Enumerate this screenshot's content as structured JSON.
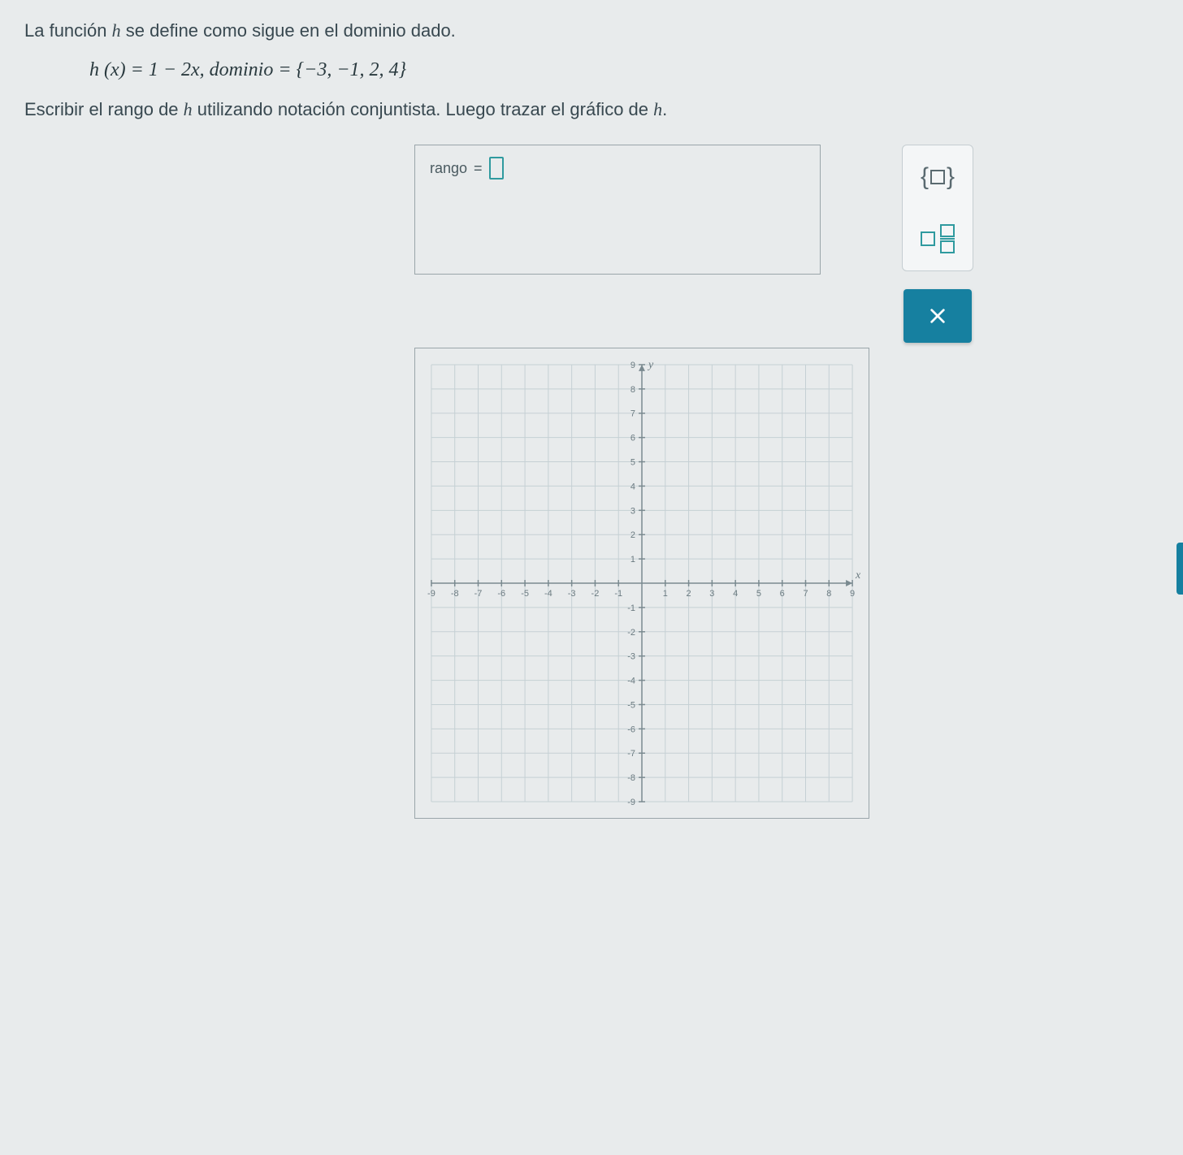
{
  "problem": {
    "line1_a": "La función ",
    "line1_b": " se define como sigue en el dominio dado.",
    "func_var": "h",
    "equation": "h (x) = 1 − 2x,   dominio  = {−3, −1, 2, 4}",
    "instruction_a": "Escribir el rango de ",
    "instruction_b": " utilizando notación conjuntista. Luego trazar el gráfico de ",
    "instruction_c": "."
  },
  "rango": {
    "label": "rango",
    "equals": "="
  },
  "graph": {
    "x_label": "x",
    "y_label": "y",
    "x_range": [
      -9,
      9
    ],
    "y_range": [
      -9,
      9
    ],
    "ticks": [
      -9,
      -8,
      -7,
      -6,
      -5,
      -4,
      -3,
      -2,
      -1,
      1,
      2,
      3,
      4,
      5,
      6,
      7,
      8,
      9
    ]
  },
  "tools": {
    "set_braces": "set-notation",
    "fraction": "fraction",
    "close": "close"
  }
}
